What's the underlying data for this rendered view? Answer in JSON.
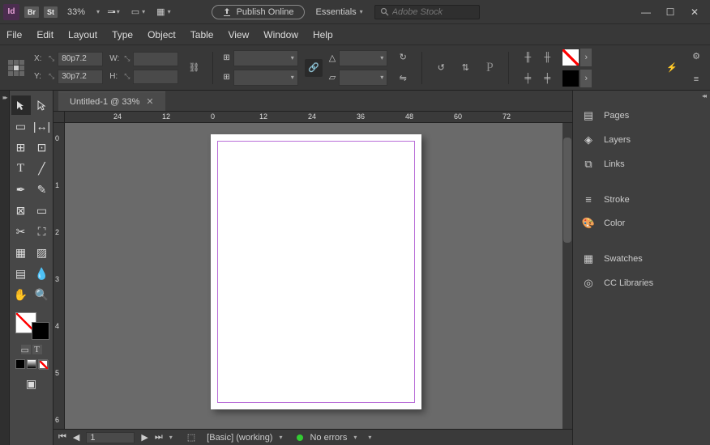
{
  "topbar": {
    "logo": "Id",
    "chips": [
      "Br",
      "St"
    ],
    "zoom": "33%",
    "publish": "Publish Online",
    "workspace": "Essentials",
    "search_placeholder": "Adobe Stock"
  },
  "menu": [
    "File",
    "Edit",
    "Layout",
    "Type",
    "Object",
    "Table",
    "View",
    "Window",
    "Help"
  ],
  "ctrl": {
    "x": "80p7.2",
    "y": "30p7.2",
    "w": "",
    "h": "",
    "xl": "X:",
    "yl": "Y:",
    "wl": "W:",
    "hl": "H:"
  },
  "tab": {
    "title": "Untitled-1 @ 33%"
  },
  "ruler_h": [
    {
      "v": "24",
      "px": 60
    },
    {
      "v": "12",
      "px": 120
    },
    {
      "v": "0",
      "px": 180
    },
    {
      "v": "12",
      "px": 240
    },
    {
      "v": "24",
      "px": 300
    },
    {
      "v": "36",
      "px": 360
    },
    {
      "v": "48",
      "px": 420
    },
    {
      "v": "60",
      "px": 480
    },
    {
      "v": "72",
      "px": 540
    }
  ],
  "ruler_v": [
    {
      "v": "0",
      "px": 14
    },
    {
      "v": "1",
      "px": 72
    },
    {
      "v": "2",
      "px": 130
    },
    {
      "v": "3",
      "px": 188
    },
    {
      "v": "4",
      "px": 246
    },
    {
      "v": "5",
      "px": 304
    },
    {
      "v": "6",
      "px": 362
    }
  ],
  "status": {
    "page": "1",
    "profile": "[Basic] (working)",
    "errors": "No errors"
  },
  "panels": {
    "g1": [
      {
        "icon": "pages",
        "label": "Pages"
      },
      {
        "icon": "layers",
        "label": "Layers"
      },
      {
        "icon": "links",
        "label": "Links"
      }
    ],
    "g2": [
      {
        "icon": "stroke",
        "label": "Stroke"
      },
      {
        "icon": "color",
        "label": "Color"
      }
    ],
    "g3": [
      {
        "icon": "swatches",
        "label": "Swatches"
      },
      {
        "icon": "cc",
        "label": "CC Libraries"
      }
    ]
  }
}
